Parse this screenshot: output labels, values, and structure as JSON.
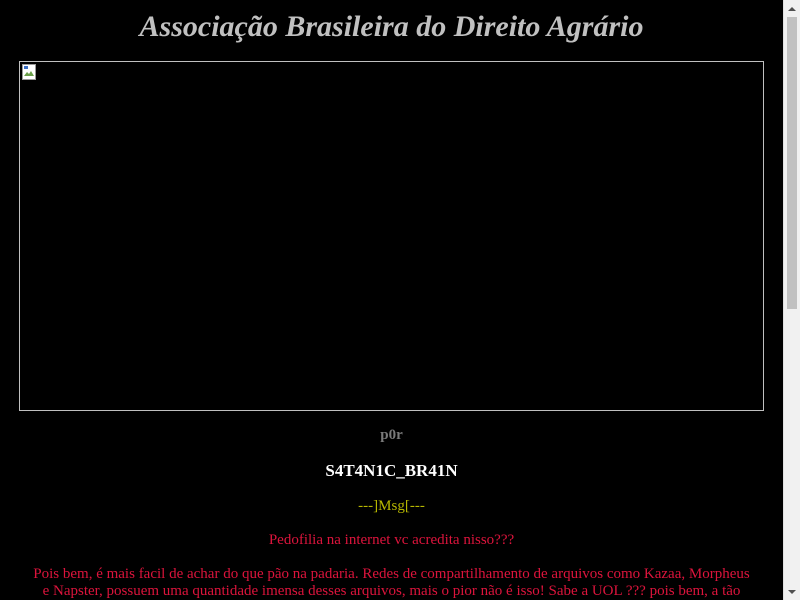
{
  "page": {
    "title": "Associação Brasileira do Direito Agrário",
    "banner_alt": "",
    "by_label": "p0r",
    "author": "S4T4N1C_BR41N",
    "msg_label": "---]Msg[---",
    "question": "Pedofilia na internet vc acredita nisso???",
    "paragraph_lines": [
      "Pois bem, é mais facil de achar do que pão na padaria. Redes de compartilhamento de arquivos como Kazaa, Morpheus",
      "e Napster, possuem uma quantidade imensa desses arquivos, mais o pior não é isso! Sabe a UOL ??? pois bem, a tão"
    ]
  },
  "colors": {
    "background": "#000000",
    "title": "#c0c0c0",
    "author": "#ffffff",
    "msg": "#b7b700",
    "text": "#dc143c"
  },
  "icons": {
    "broken_image": "broken-image-icon",
    "scroll_up": "chevron-up-icon",
    "scroll_down": "chevron-down-icon"
  }
}
